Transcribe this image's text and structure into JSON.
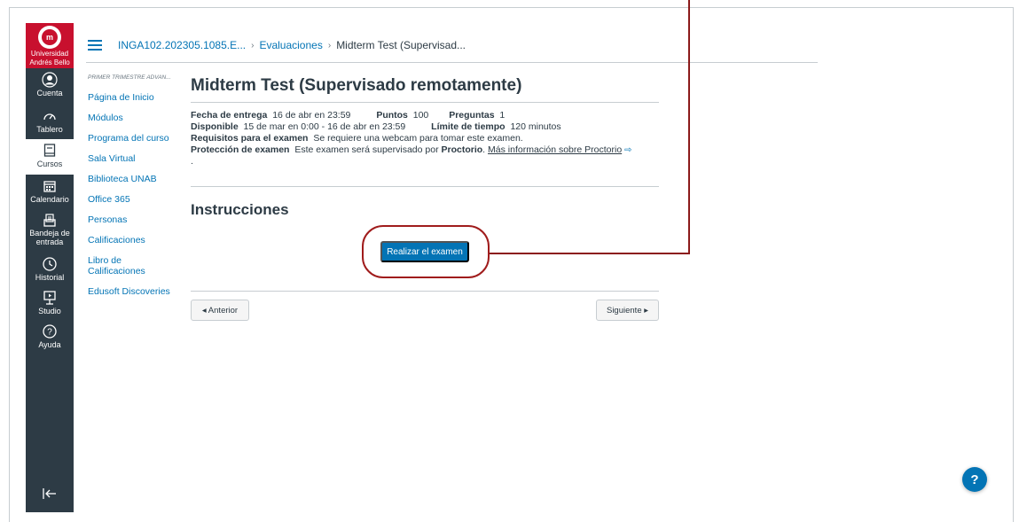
{
  "logo": {
    "text_line1": "Universidad",
    "text_line2": "Andrés Bello"
  },
  "global_nav": [
    {
      "label": "Cuenta",
      "icon": "account-icon"
    },
    {
      "label": "Tablero",
      "icon": "dashboard-icon"
    },
    {
      "label": "Cursos",
      "icon": "courses-icon",
      "active": true
    },
    {
      "label": "Calendario",
      "icon": "calendar-icon"
    },
    {
      "label": "Bandeja de entrada",
      "icon": "inbox-icon"
    },
    {
      "label": "Historial",
      "icon": "history-icon"
    },
    {
      "label": "Studio",
      "icon": "studio-icon"
    },
    {
      "label": "Ayuda",
      "icon": "help-icon"
    }
  ],
  "breadcrumb": {
    "course": "INGA102.202305.1085.E...",
    "section": "Evaluaciones",
    "current": "Midterm Test (Supervisad..."
  },
  "course_nav": {
    "term": "PRIMER TRIMESTRE ADVAN...",
    "items": [
      "Página de Inicio",
      "Módulos",
      "Programa del curso",
      "Sala Virtual",
      "Biblioteca UNAB",
      "Office 365",
      "Personas",
      "Calificaciones",
      "Libro de Calificaciones",
      "Edusoft Discoveries"
    ]
  },
  "quiz": {
    "title": "Midterm Test (Supervisado remotamente)",
    "due_label": "Fecha de entrega",
    "due_value": "16 de abr en 23:59",
    "points_label": "Puntos",
    "points_value": "100",
    "questions_label": "Preguntas",
    "questions_value": "1",
    "available_label": "Disponible",
    "available_value": "15 de mar en 0:00 - 16 de abr en 23:59",
    "time_limit_label": "Límite de tiempo",
    "time_limit_value": "120 minutos",
    "requirements_label": "Requisitos para el examen",
    "requirements_value": "Se requiere una webcam para tomar este examen.",
    "protection_label": "Protección de examen",
    "protection_text": "Este examen será supervisado por",
    "protection_provider": "Proctorio",
    "protection_link": "Más información sobre Proctorio",
    "trailing_dot": ".",
    "instructions_heading": "Instrucciones",
    "take_button": "Realizar el examen",
    "prev_button": "◂ Anterior",
    "next_button": "Siguiente ▸"
  },
  "colors": {
    "nav_bg": "#2d3b45",
    "brand_red": "#c8102e",
    "link": "#0374b5",
    "annotation": "#a01c1c"
  }
}
